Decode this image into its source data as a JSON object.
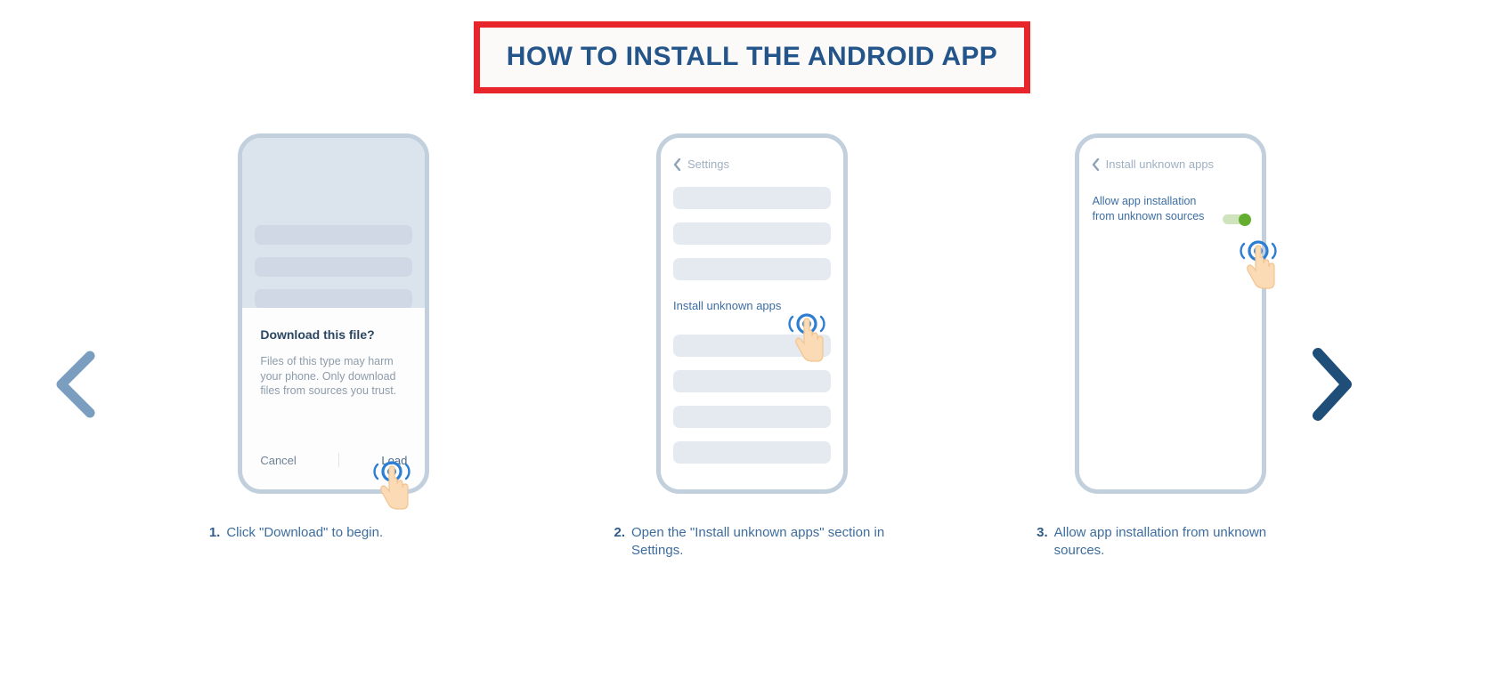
{
  "header": {
    "title": "HOW TO INSTALL THE ANDROID APP",
    "title_color": "#23558a",
    "border_color": "#e8252a"
  },
  "nav": {
    "prev_icon": "chevron-left-icon",
    "next_icon": "chevron-right-icon",
    "prev_color": "#7b9dc0",
    "next_color": "#1f4e79"
  },
  "steps": [
    {
      "number": "1.",
      "caption": "Click \"Download\" to begin.",
      "phone": {
        "dialog": {
          "title": "Download this file?",
          "body": "Files of this type may harm your phone. Only download files from sources you trust.",
          "cancel_label": "Cancel",
          "load_label": "Load"
        },
        "tap_icon": "tap-hand-icon"
      }
    },
    {
      "number": "2.",
      "caption": "Open the \"Install unknown apps\" section in Settings.",
      "phone": {
        "header_back_icon": "chevron-left-icon",
        "header_title": "Settings",
        "mid_label": "Install unknown apps",
        "tap_icon": "tap-hand-icon"
      }
    },
    {
      "number": "3.",
      "caption": "Allow app installation from unknown sources.",
      "phone": {
        "header_back_icon": "chevron-left-icon",
        "header_title": "Install unknown apps",
        "toggle_label": "Allow app installation from unknown sources",
        "toggle_state": "on",
        "toggle_on_color": "#63ae2e",
        "tap_icon": "tap-hand-icon"
      }
    }
  ]
}
